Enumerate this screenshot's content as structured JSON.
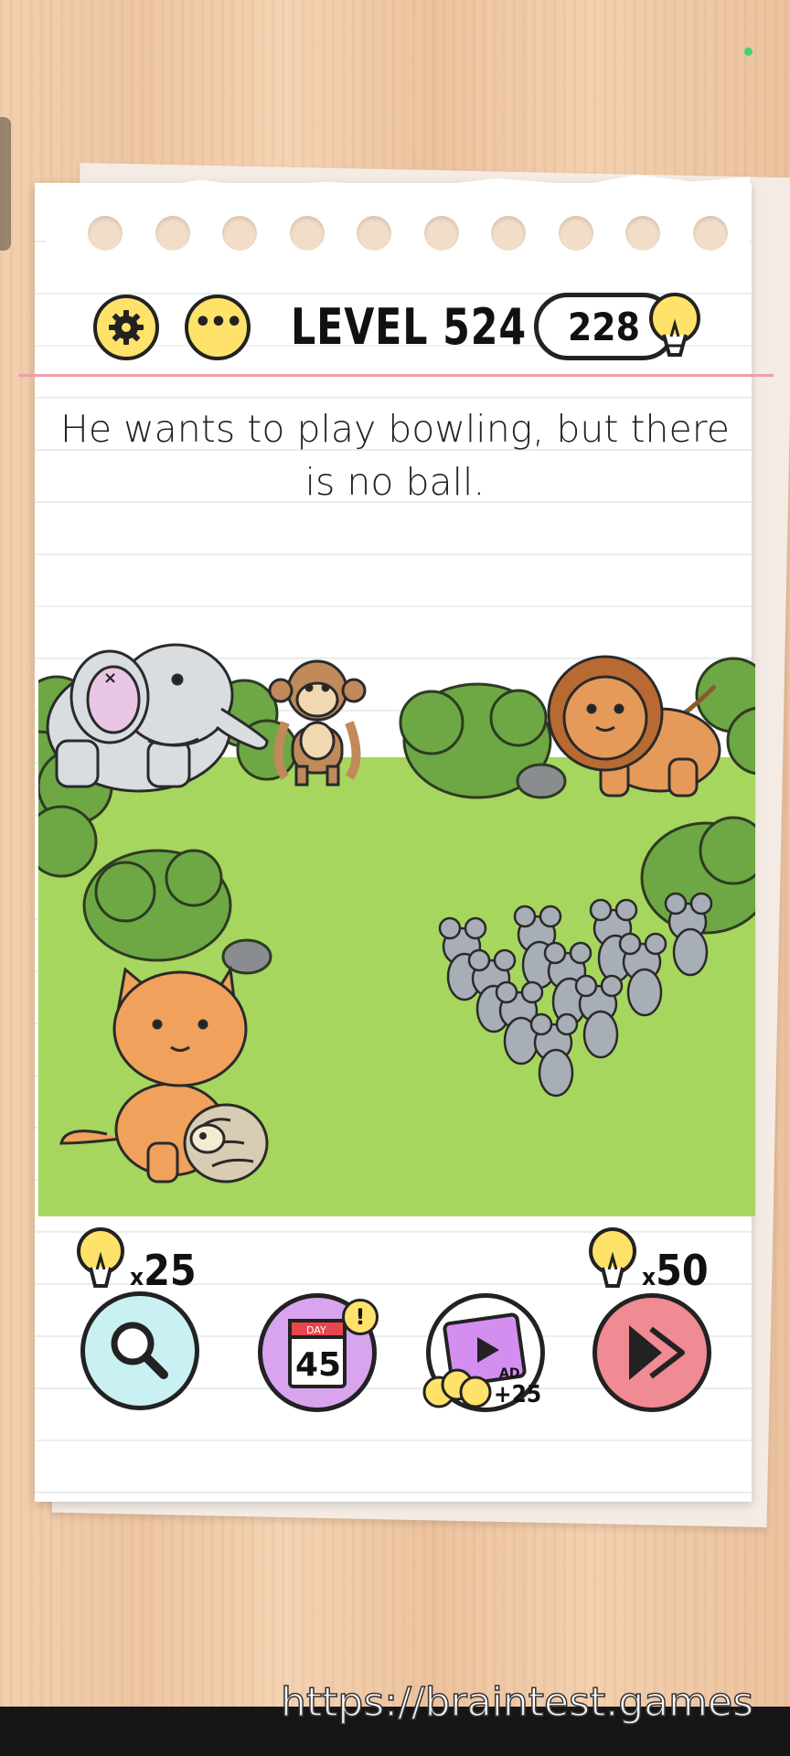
{
  "header": {
    "level_label": "LEVEL 524",
    "hint_balance": "228"
  },
  "puzzle": {
    "question": "He wants to play bowling, but there is no ball."
  },
  "scene": {
    "characters": [
      "elephant",
      "monkey",
      "lion",
      "cat",
      "hedgehog",
      "mice-group"
    ],
    "colors": {
      "grass": "#a6d65d",
      "bush": "#6da844",
      "lion": "#e59a5a",
      "elephant": "#d9dde0",
      "mouse": "#a8aeb5"
    }
  },
  "toolbar": {
    "search_cost_x": "x",
    "search_cost": "25",
    "skip_cost_x": "x",
    "skip_cost": "50",
    "daily_day": "DAY",
    "daily_number": "45",
    "ad_label": "AD",
    "ad_reward": "+25"
  },
  "footer": {
    "watermark": "https://braintest.games"
  }
}
